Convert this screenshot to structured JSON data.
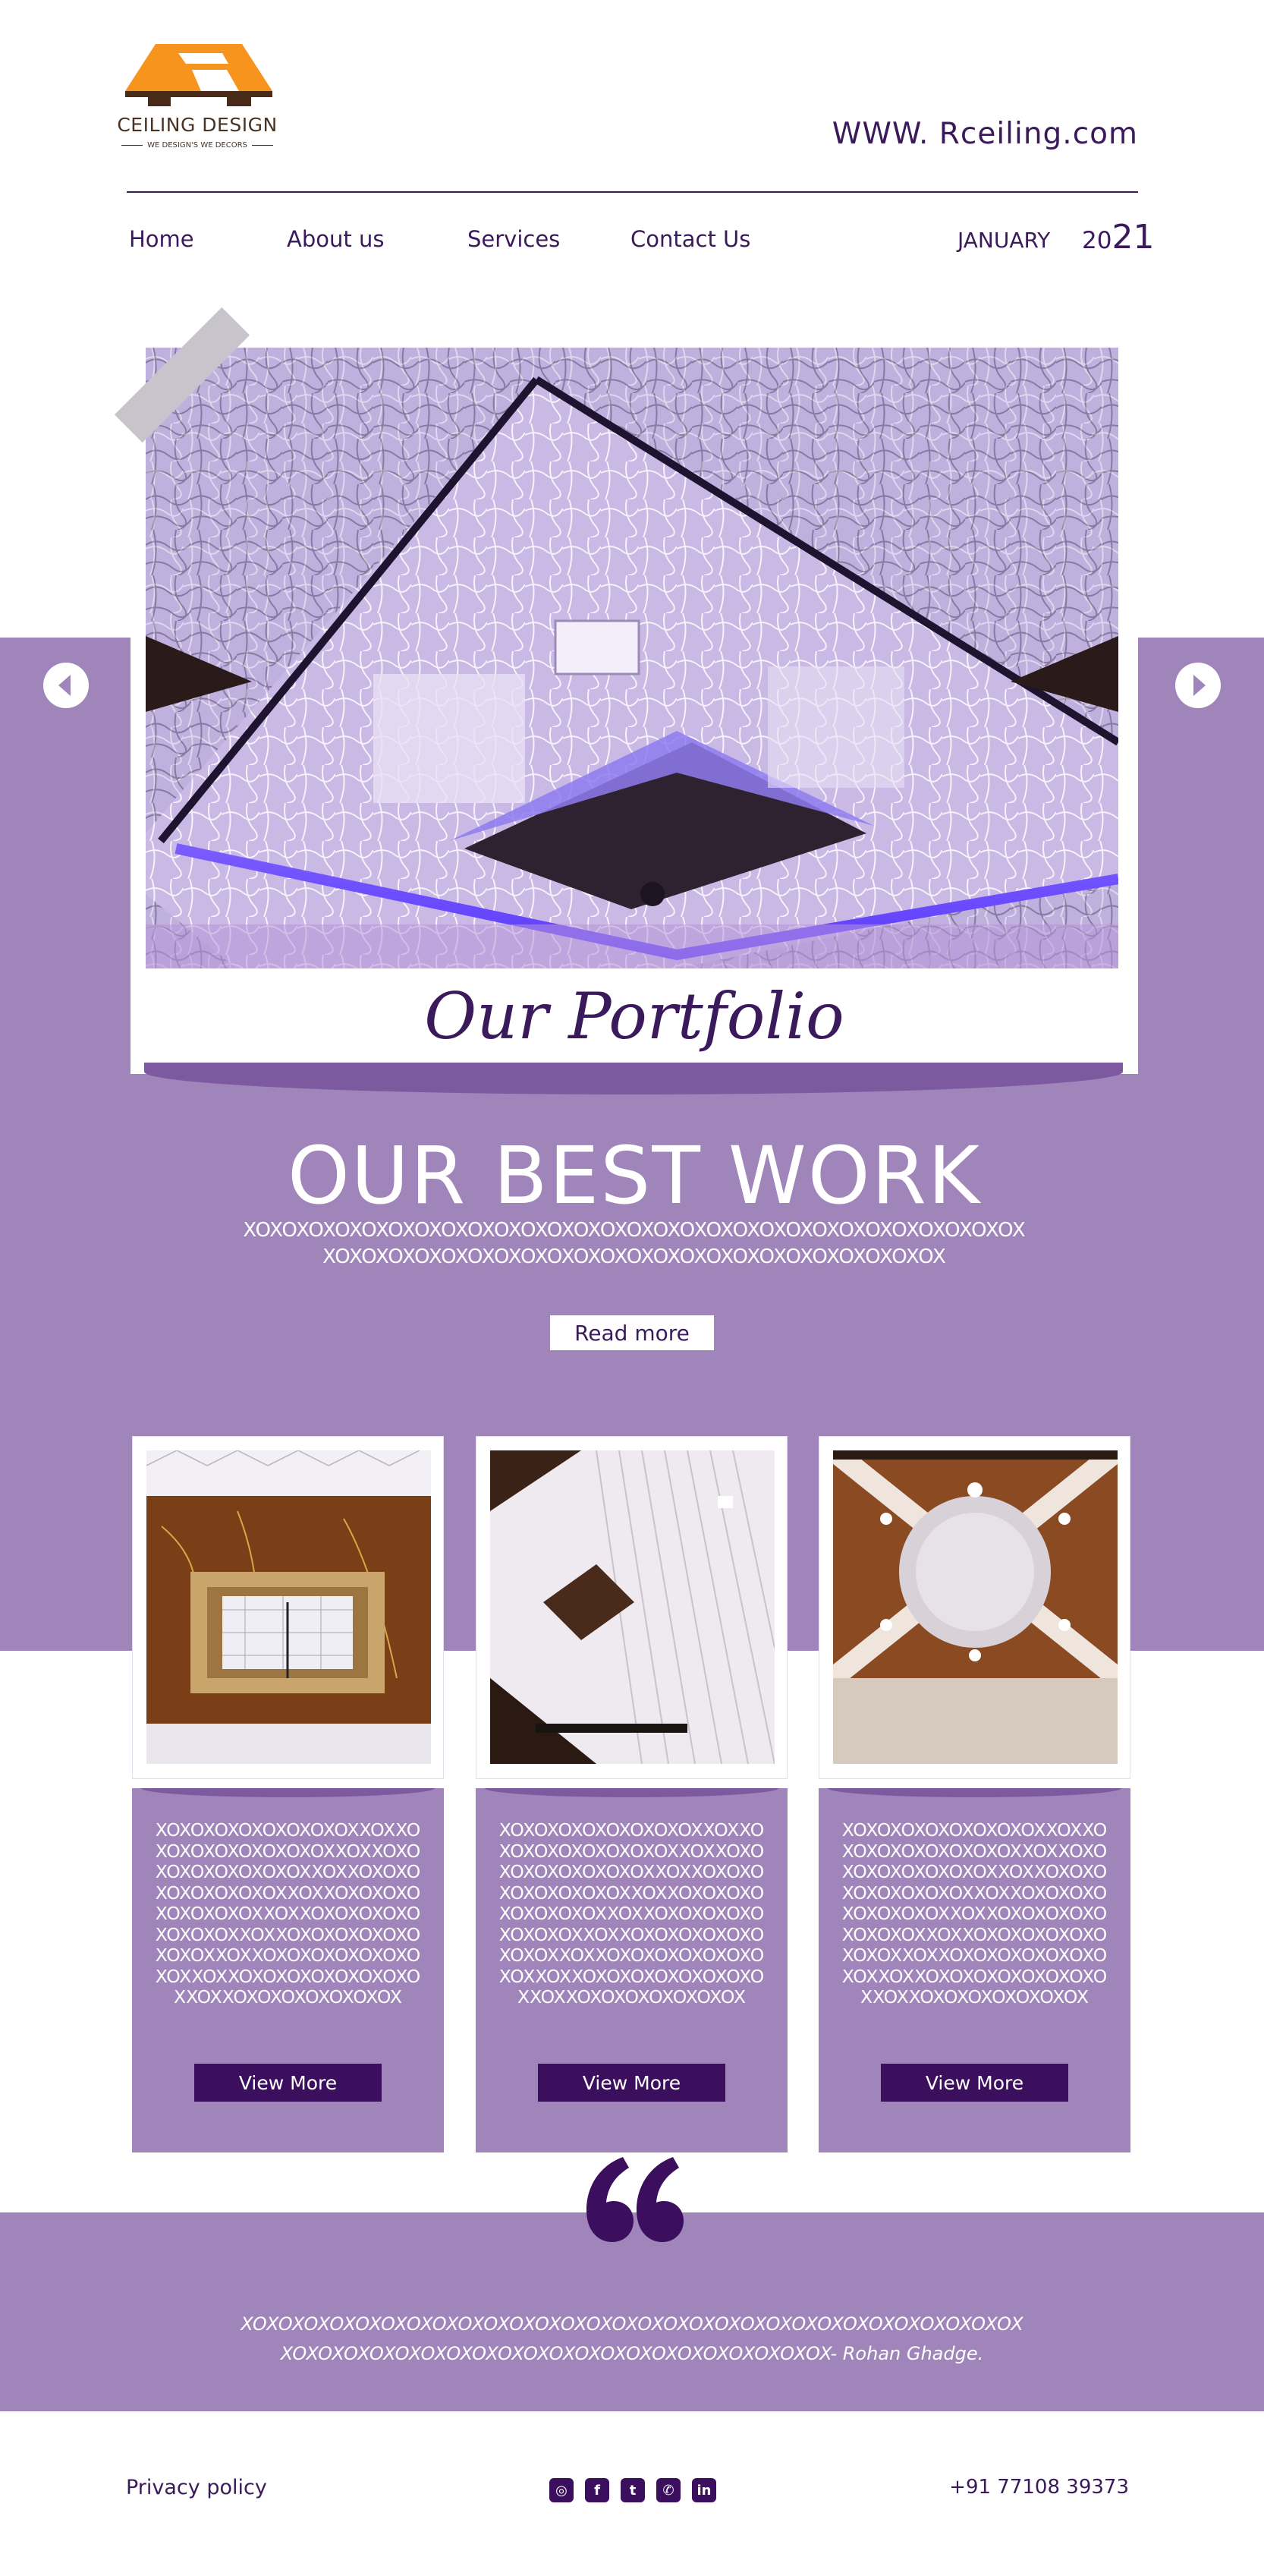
{
  "brand": {
    "logo_text": "CEILING DESIGN",
    "logo_tagline": "WE DESIGN'S WE DECORS",
    "url": "WWW. Rceiling.com"
  },
  "nav": {
    "items": [
      "Home",
      "About us",
      "Services",
      "Contact Us"
    ],
    "date_month": "JANUARY",
    "date_year_prefix": "20",
    "date_year_suffix": "21"
  },
  "hero": {
    "portfolio_title": "Our Portfolio",
    "heading": "OUR BEST WORK",
    "body_line1": "XOXOXOXOXOXOXOXOXOXOXOXOXOXOXOXOXOXOXOXOXOXOXOXOXOXOXOXOXOX",
    "body_line2": "XOXOXOXOXOXOXOXOXOXOXOXOXOXOXOXOXOXOXOXOXOXOXOX",
    "read_more": "Read more"
  },
  "cards": [
    {
      "text": "XOXOXOXOXOXOXOXOXXOXXOXOXOXOXOXOXOXOXXOXXOXOXOXOXOXOXOXOXXOXXOXOXOXOXOXOXOXOXXOXXOXOXOXOXOXOXOXOXXOXXOXOXOXOXOXOXOXOXXOXXOXOXOXOXOXOXOXOXXOXXOXOXOXOXOXOXOXOXXOXXOXOXOXOXOXOXOXOXXOXXOXOXOXOXOXOXOX",
      "button": "View More"
    },
    {
      "text": "XOXOXOXOXOXOXOXOXXOXXOXOXOXOXOXOXOXOXXOXXOXOXOXOXOXOXOXOXXOXXOXOXOXOXOXOXOXOXXOXXOXOXOXOXOXOXOXOXXOXXOXOXOXOXOXOXOXOXXOXXOXOXOXOXOXOXOXOXXOXXOXOXOXOXOXOXOXOXXOXXOXOXOXOXOXOXOXOXXOXXOXOXOXOXOXOXOX",
      "button": "View More"
    },
    {
      "text": "XOXOXOXOXOXOXOXOXXOXXOXOXOXOXOXOXOXOXXOXXOXOXOXOXOXOXOXOXXOXXOXOXOXOXOXOXOXOXXOXXOXOXOXOXOXOXOXOXXOXXOXOXOXOXOXOXOXOXXOXXOXOXOXOXOXOXOXOXXOXXOXOXOXOXOXOXOXOXXOXXOXOXOXOXOXOXOXOXXOXXOXOXOXOXOXOXOX",
      "button": "View More"
    }
  ],
  "testimonial": {
    "line1": "XOXOXOXOXOXOXOXOXOXOXOXOXOXOXOXOXOXOXOXOXOXOXOXOXOXOXOXOXOXOX",
    "line2": "XOXOXOXOXOXOXOXOXOXOXOXOXOXOXOXOXOXOXOXOXOX- Rohan Ghadge."
  },
  "footer": {
    "privacy": "Privacy policy",
    "phone": "+91 77108 39373",
    "social_icons": [
      "instagram-icon",
      "facebook-icon",
      "twitter-icon",
      "whatsapp-icon",
      "linkedin-icon"
    ]
  },
  "colors": {
    "primary": "#3b1a5c",
    "band": "#a085bb",
    "button": "#3b0f5e",
    "logo_orange": "#f7941d"
  }
}
